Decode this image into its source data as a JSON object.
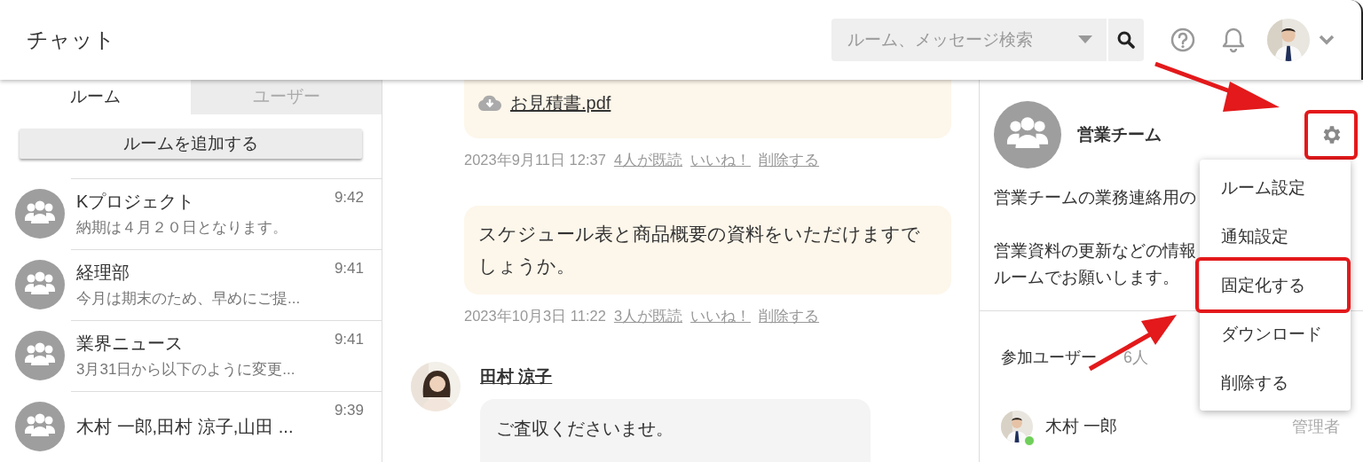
{
  "header": {
    "title": "チャット",
    "search": {
      "placeholder": "ルーム、メッセージ検索"
    }
  },
  "sidebar": {
    "tabs": [
      {
        "label": "ルーム",
        "selected": true
      },
      {
        "label": "ユーザー",
        "selected": false
      }
    ],
    "add_button": "ルームを追加する",
    "rooms": [
      {
        "name": "Kプロジェクト",
        "preview": "納期は４月２０日となります。",
        "time": "9:42"
      },
      {
        "name": "経理部",
        "preview": "今月は期末のため、早めにご提...",
        "time": "9:41"
      },
      {
        "name": "業界ニュース",
        "preview": "3月31日から以下のように変更...",
        "time": "9:41"
      },
      {
        "name": "木村 一郎,田村 涼子,山田 ...",
        "time": "9:39"
      }
    ]
  },
  "messages": [
    {
      "kind": "file",
      "file": "お見積書.pdf",
      "date": "2023年9月11日 12:37",
      "read": "4人が既読",
      "like": "いいね！",
      "delete": "削除する"
    },
    {
      "kind": "text",
      "text": "スケジュール表と商品概要の資料をいただけますでしょうか。",
      "date": "2023年10月3日 11:22",
      "read": "3人が既読",
      "like": "いいね！",
      "delete": "削除する"
    },
    {
      "kind": "incoming",
      "sender": "田村 涼子",
      "text": "ご査収くださいませ。"
    }
  ],
  "room_panel": {
    "name": "営業チーム",
    "settings_highlighted": true,
    "description": [
      [
        "営業チームの業務連絡用の"
      ],
      [
        "営業資料の更新などの情報",
        "ルームでお願いします。"
      ]
    ],
    "members_label": "参加ユーザー",
    "member_count": "6人",
    "members": [
      {
        "name": "木村 一郎",
        "role": "管理者",
        "online": true
      }
    ],
    "menu": [
      {
        "label": "ルーム設定",
        "highlighted": false
      },
      {
        "label": "通知設定",
        "highlighted": false
      },
      {
        "label": "固定化する",
        "highlighted": true
      },
      {
        "label": "ダウンロード",
        "highlighted": false
      },
      {
        "label": "削除する",
        "highlighted": false
      }
    ]
  }
}
